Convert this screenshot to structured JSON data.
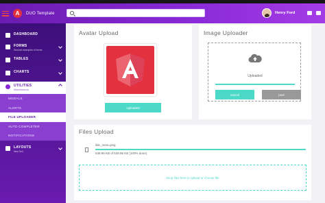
{
  "header": {
    "title": "DUO Template",
    "logo_letter": "A",
    "search_placeholder": "",
    "user_name": "Henry Ford"
  },
  "sidebar": {
    "items": [
      {
        "label": "DASHBOARD",
        "sub": ""
      },
      {
        "label": "FORMS",
        "sub": "Several examples of forms"
      },
      {
        "label": "TABLES",
        "sub": ""
      },
      {
        "label": "CHARTS",
        "sub": ""
      },
      {
        "label": "UTILITIES",
        "sub": "Miscellaneous"
      },
      {
        "label": "LAYOUTS",
        "sub": "Nav/ 5x3"
      }
    ],
    "utilities_sub": [
      "MODALS",
      "ALERTS",
      "FILE UPLOADER",
      "AUTO COMPLETER",
      "NOTIFICATIONS"
    ]
  },
  "avatar_upload": {
    "title": "Avatar Upload",
    "button": "Uploaded"
  },
  "image_uploader": {
    "title": "Image Uploader",
    "status": "Uploaded",
    "progress": 1.0,
    "cancel": "cancel",
    "post": "post"
  },
  "files_upload": {
    "title": "Files Upload",
    "file_name": "ilde_menu.png",
    "file_meta": "538.96 KB of 538.96 KB (100% done)",
    "progress": 1.0,
    "drop_text": "Drop files here to upload or choose file"
  },
  "colors": {
    "accent": "#4dd9c8",
    "brand": "#6a1bb0",
    "angular": "#e4313f"
  }
}
